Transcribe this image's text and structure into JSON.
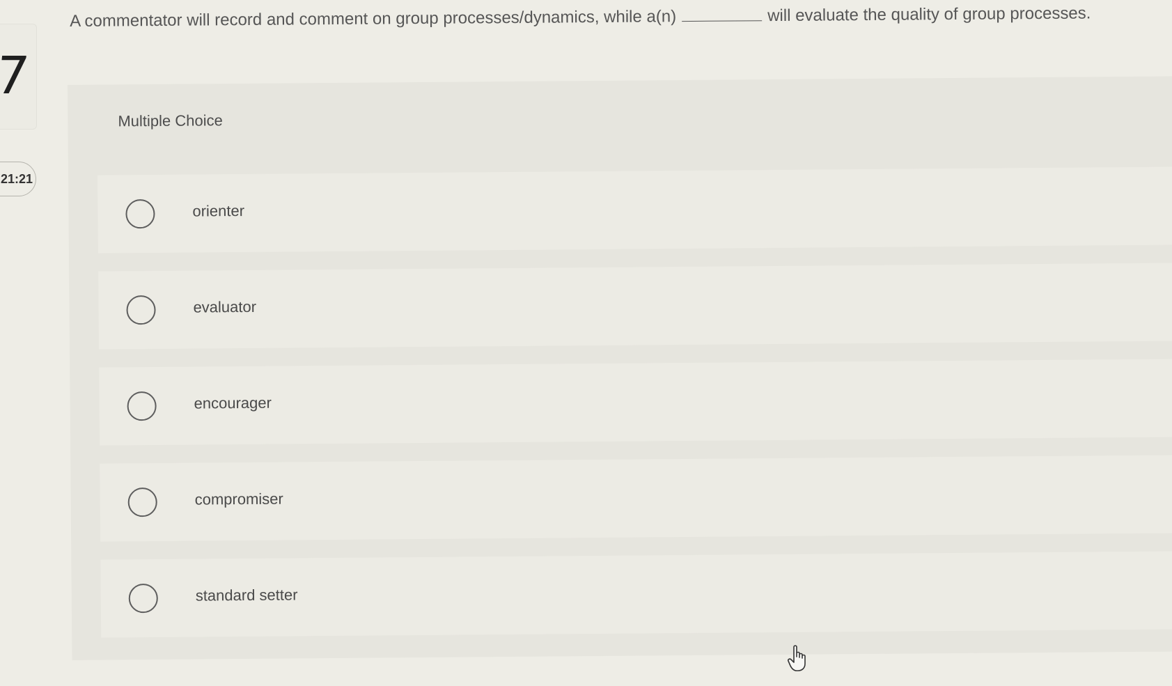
{
  "question": {
    "number": "7",
    "text_before": "A commentator will record and comment on group processes/dynamics, while a(n)",
    "text_after": "will evaluate the quality of group processes."
  },
  "timer": {
    "value": "21:21"
  },
  "panel": {
    "type_label": "Multiple Choice",
    "options": [
      {
        "label": "orienter",
        "selected": false
      },
      {
        "label": "evaluator",
        "selected": false
      },
      {
        "label": "encourager",
        "selected": false
      },
      {
        "label": "compromiser",
        "selected": false
      },
      {
        "label": "standard setter",
        "selected": false
      }
    ]
  },
  "cursor": {
    "icon": "hand-pointer-icon"
  }
}
